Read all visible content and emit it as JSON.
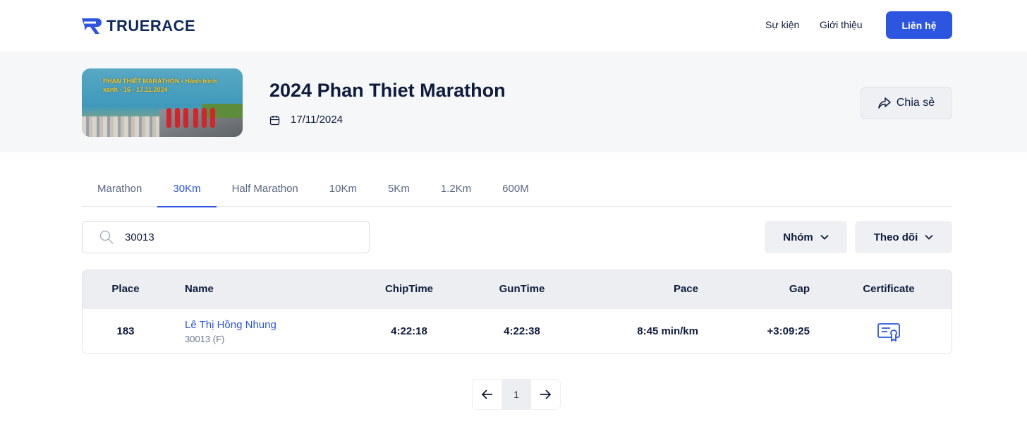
{
  "header": {
    "brand": "TRUERACE",
    "nav": [
      "Sự kiện",
      "Giới thiệu"
    ],
    "contact_label": "Liên hệ",
    "accent": "#2c55e0"
  },
  "event": {
    "title": "2024 Phan Thiet Marathon",
    "date": "17/11/2024",
    "share_label": "Chia sẻ",
    "image_text": "PHAN THIẾT MARATHON - Hành trình xanh - 16 - 17.11.2024"
  },
  "tabs": [
    {
      "label": "Marathon",
      "active": false
    },
    {
      "label": "30Km",
      "active": true
    },
    {
      "label": "Half Marathon",
      "active": false
    },
    {
      "label": "10Km",
      "active": false
    },
    {
      "label": "5Km",
      "active": false
    },
    {
      "label": "1.2Km",
      "active": false
    },
    {
      "label": "600M",
      "active": false
    }
  ],
  "search": {
    "value": "30013"
  },
  "filters": {
    "group_label": "Nhóm",
    "follow_label": "Theo dõi"
  },
  "table": {
    "columns": [
      "Place",
      "Name",
      "ChipTime",
      "GunTime",
      "Pace",
      "Gap",
      "Certificate"
    ],
    "rows": [
      {
        "place": "183",
        "name": "Lê Thị Hồng Nhung",
        "bib": "30013 (F)",
        "chip_time": "4:22:18",
        "gun_time": "4:22:38",
        "pace": "8:45 min/km",
        "gap": "+3:09:25",
        "certificate_icon": "certificate-icon"
      }
    ]
  },
  "pagination": {
    "current": "1"
  }
}
